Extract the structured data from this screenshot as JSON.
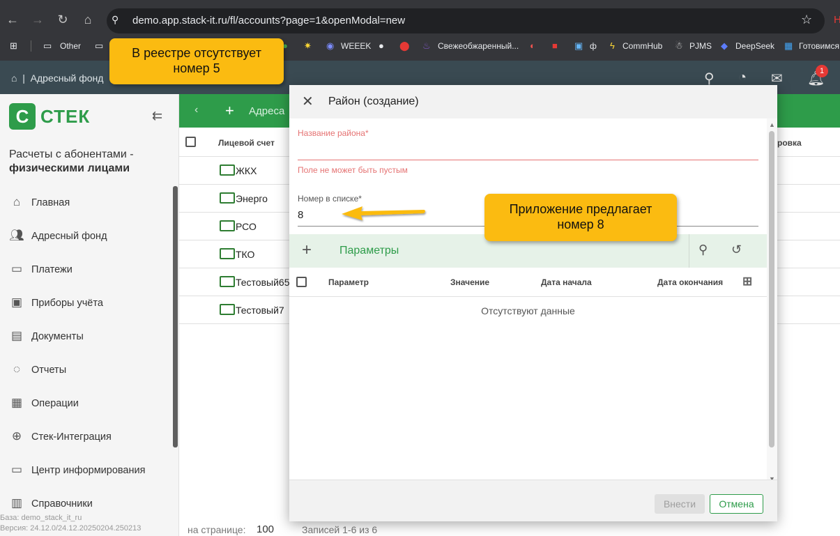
{
  "browser": {
    "url": "demo.app.stack-it.ru/fl/accounts?page=1&openModal=new",
    "bookmarks": [
      {
        "label": "Other"
      },
      {
        "label": "WEEEK"
      },
      {
        "label": "Свежеобжаренный..."
      },
      {
        "label": "ф"
      },
      {
        "label": "CommHub"
      },
      {
        "label": "PJMS"
      },
      {
        "label": "DeepSeek"
      },
      {
        "label": "Готовимся"
      }
    ],
    "profile_letter": "Н"
  },
  "app_header": {
    "breadcrumb": "Адресный фонд",
    "notification_count": "1"
  },
  "sidebar": {
    "logo_text": "СТЕК",
    "title_line1": "Расчеты с абонентами -",
    "title_line2": "физическими лицами",
    "items": [
      {
        "label": "Главная"
      },
      {
        "label": "Адресный фонд"
      },
      {
        "label": "Платежи"
      },
      {
        "label": "Приборы учёта"
      },
      {
        "label": "Документы"
      },
      {
        "label": "Отчеты"
      },
      {
        "label": "Операции"
      },
      {
        "label": "Стек-Интеграция"
      },
      {
        "label": "Центр информирования"
      },
      {
        "label": "Справочники"
      }
    ],
    "footer_db": "База: demo_stack_it_ru",
    "footer_version": "Версия: 24.12.0/24.12.20250204.250213"
  },
  "main": {
    "toolbar_label": "Адреса",
    "col_account": "Лицевой счет",
    "col_right": "ровка",
    "rows": [
      {
        "name": "ЖКХ"
      },
      {
        "name": "Энерго"
      },
      {
        "name": "РСО"
      },
      {
        "name": "ТКО"
      },
      {
        "name": "Тестовый65"
      },
      {
        "name": "Тестовый7"
      }
    ],
    "per_page_label": "на странице:",
    "per_page_value": "100",
    "records": "Записей 1-6 из 6"
  },
  "modal": {
    "title": "Район (создание)",
    "name_label": "Название района*",
    "name_error": "Поле не может быть пустым",
    "number_label": "Номер в списке*",
    "number_value": "8",
    "params_label": "Параметры",
    "columns": [
      "Параметр",
      "Значение",
      "Дата начала",
      "Дата окончания"
    ],
    "empty_text": "Отсутствуют данные",
    "btn_apply": "Внести",
    "btn_cancel": "Отмена"
  },
  "callouts": {
    "registry_line1": "В реестре отсутствует",
    "registry_line2": "номер 5",
    "app_line1": "Приложение предлагает",
    "app_line2": "номер 8"
  },
  "colors": {
    "brand_green": "#2e9c4a",
    "callout": "#fbbb11",
    "error": "#e57373"
  }
}
